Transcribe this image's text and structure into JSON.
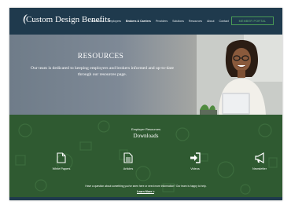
{
  "brand": {
    "name": "Custom Design Benefits"
  },
  "nav": {
    "items": [
      "Members",
      "Employers",
      "Brokers & Carriers",
      "Providers",
      "Solutions",
      "Resources",
      "About",
      "Contact"
    ],
    "active_index": 2,
    "portal_label": "MEMBER PORTAL"
  },
  "hero": {
    "title": "RESOURCES",
    "description": "Our team is dedicated to keeping employers and brokers informed and up-to-date through our resources page."
  },
  "downloads": {
    "subtitle": "Employer Resources",
    "title": "Downloads",
    "items": [
      {
        "label": "White Papers",
        "icon": "document-icon"
      },
      {
        "label": "Articles",
        "icon": "article-icon"
      },
      {
        "label": "Videos",
        "icon": "video-arrow-icon"
      },
      {
        "label": "Newsletter",
        "icon": "megaphone-icon"
      }
    ],
    "cta_text": "Have a question about something you've seen here or need more information? Our team is happy to help.",
    "cta_link": "Learn More >"
  },
  "colors": {
    "nav": "#1f3a4d",
    "accent_green": "#4a9b55",
    "section_green": "#2f5a31"
  }
}
